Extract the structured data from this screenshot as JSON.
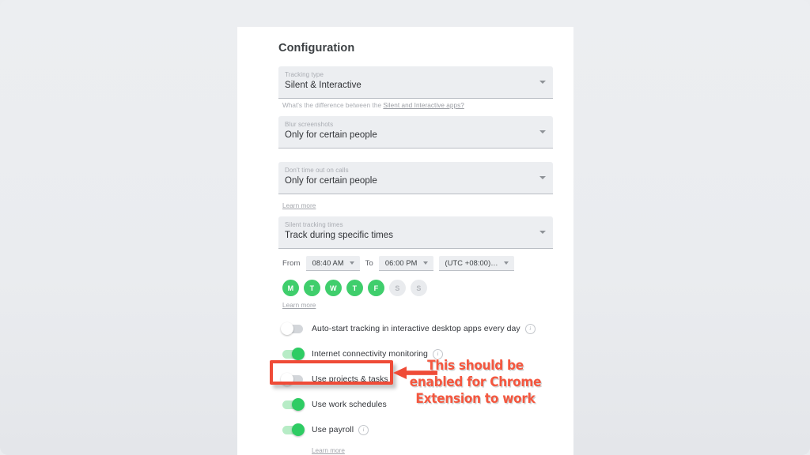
{
  "page": {
    "title": "Configuration",
    "background_color": "#ebedf0",
    "card_color": "#ffffff",
    "accent_green": "#2ecc63",
    "annotation_red": "#ef4b37"
  },
  "fields": [
    {
      "label": "Tracking type",
      "value": "Silent & Interactive",
      "helper_prefix": "What's the difference between the ",
      "helper_link": "Silent and Interactive apps?"
    },
    {
      "label": "Blur screenshots",
      "value": "Only for certain people"
    },
    {
      "label": "Don't time out on calls",
      "value": "Only for certain people",
      "learn_more": "Learn more"
    },
    {
      "label": "Silent tracking times",
      "value": "Track during specific times"
    }
  ],
  "time_row": {
    "from_label": "From",
    "from_value": "08:40 AM",
    "to_label": "To",
    "to_value": "06:00 PM",
    "timezone_value": "(UTC +08:00)…"
  },
  "days": [
    {
      "letter": "M",
      "active": true
    },
    {
      "letter": "T",
      "active": true
    },
    {
      "letter": "W",
      "active": true
    },
    {
      "letter": "T",
      "active": true
    },
    {
      "letter": "F",
      "active": true
    },
    {
      "letter": "S",
      "active": false
    },
    {
      "letter": "S",
      "active": false
    }
  ],
  "days_learn_more": "Learn more",
  "toggles": [
    {
      "label": "Auto-start tracking in interactive desktop apps every day",
      "on": false,
      "info": true
    },
    {
      "label": "Internet connectivity monitoring",
      "on": true,
      "info": true
    },
    {
      "label": "Use projects & tasks",
      "on": false,
      "info": false,
      "highlighted": true
    },
    {
      "label": "Use work schedules",
      "on": true,
      "info": false
    },
    {
      "label": "Use payroll",
      "on": true,
      "info": true,
      "sub_link": "Learn more"
    }
  ],
  "annotation": {
    "line1": "This should be",
    "line2": "enabled for Chrome",
    "line3": "Extension to work"
  }
}
